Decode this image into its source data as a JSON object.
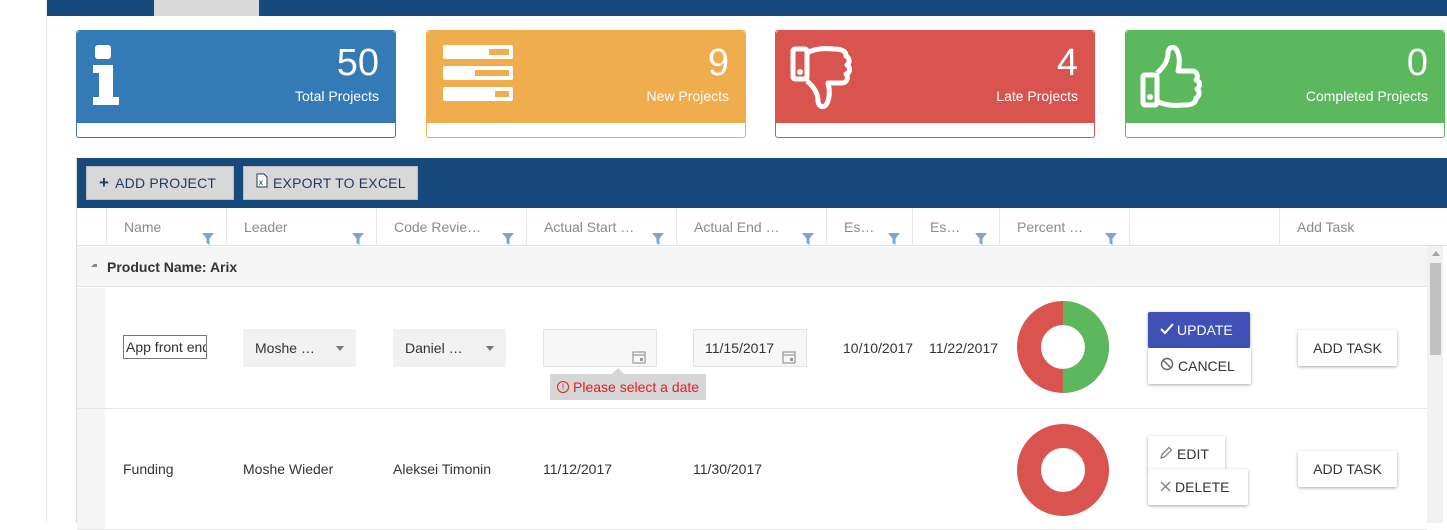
{
  "cards": [
    {
      "value": "50",
      "label": "Total Projects",
      "color": "#337ab7",
      "icon": "info-icon"
    },
    {
      "value": "9",
      "label": "New Projects",
      "color": "#f0ad4e",
      "icon": "list-icon"
    },
    {
      "value": "4",
      "label": "Late Projects",
      "color": "#d9534f",
      "icon": "thumbs-down-icon"
    },
    {
      "value": "0",
      "label": "Completed Projects",
      "color": "#5cb85c",
      "icon": "thumbs-up-icon"
    }
  ],
  "toolbar": {
    "add_project": "ADD PROJECT",
    "export_excel": "EXPORT TO EXCEL"
  },
  "columns": [
    "Name",
    "Leader",
    "Code Revie…",
    "Actual Start …",
    "Actual End …",
    "Es…",
    "Es…",
    "Percent …",
    "",
    "Add Task"
  ],
  "group": {
    "label": "Product Name: Arix"
  },
  "rows": [
    {
      "name": "App front end",
      "leader": "Moshe …",
      "code_reviewer": "Daniel …",
      "actual_start": "",
      "actual_end": "11/15/2017",
      "est_start": "10/10/2017",
      "est_end": "11/22/2017",
      "percent": 0.5,
      "error": "Please select a date",
      "update": "UPDATE",
      "cancel": "CANCEL",
      "add_task": "ADD TASK"
    },
    {
      "name": "Funding",
      "leader": "Moshe Wieder",
      "code_reviewer": "Aleksei Timonin",
      "actual_start": "11/12/2017",
      "actual_end": "11/30/2017",
      "est_start": "",
      "est_end": "",
      "percent": 0,
      "edit": "EDIT",
      "delete": "DELETE",
      "add_task": "ADD TASK"
    }
  ],
  "colors": {
    "primary_dark": "#174a7c",
    "donut_done": "#5cb85c",
    "donut_left": "#d9534f",
    "update_btn": "#3f51b5",
    "error_text": "#e02020"
  }
}
